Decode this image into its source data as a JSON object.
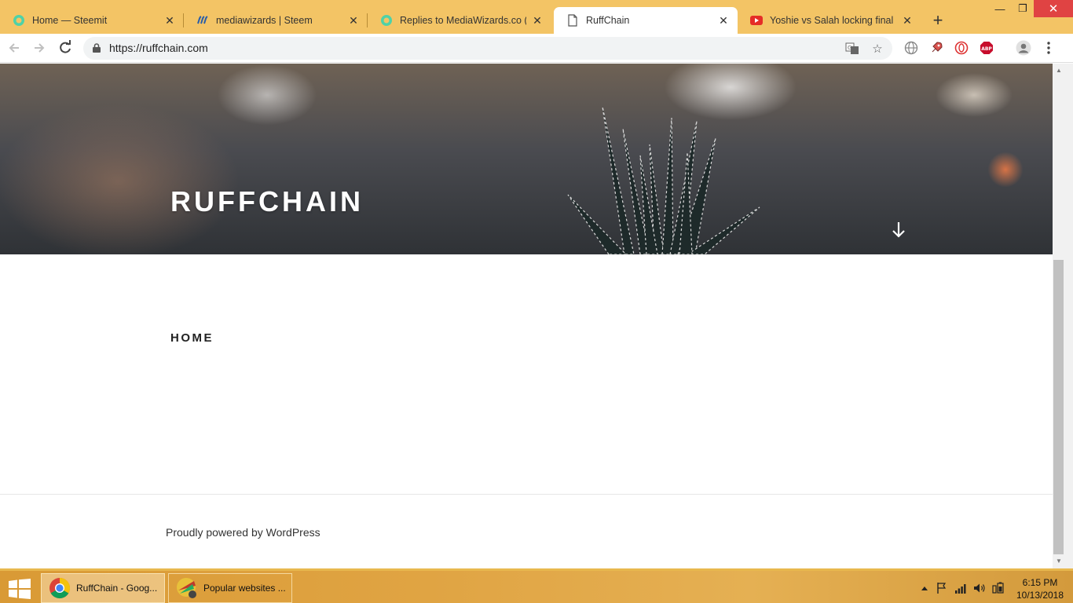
{
  "browser": {
    "tabs": [
      {
        "title": "Home — Steemit",
        "icon": "steemit-icon",
        "active": false
      },
      {
        "title": "mediawizards | Steem",
        "icon": "steem-icon",
        "active": false
      },
      {
        "title": "Replies to MediaWizards.co (@r",
        "icon": "steemit-icon",
        "active": false
      },
      {
        "title": "RuffChain",
        "icon": "page-icon",
        "active": true
      },
      {
        "title": "Yoshie vs Salah locking final SD",
        "icon": "youtube-icon",
        "active": false
      }
    ],
    "close_glyph": "✕",
    "new_tab_glyph": "+",
    "window": {
      "minimize": "—",
      "maximize": "❐",
      "close": "✕"
    },
    "url": "https://ruffchain.com",
    "accent_color": "#f3c465"
  },
  "page": {
    "site_title": "RUFFCHAIN",
    "heading": "HOME",
    "footer_text": "Proudly powered by WordPress"
  },
  "taskbar": {
    "items": [
      {
        "label": "RuffChain - Goog...",
        "icon": "chrome-icon",
        "active": true
      },
      {
        "label": "Popular websites ...",
        "icon": "app-icon",
        "active": false
      }
    ],
    "time": "6:15 PM",
    "date": "10/13/2018"
  }
}
